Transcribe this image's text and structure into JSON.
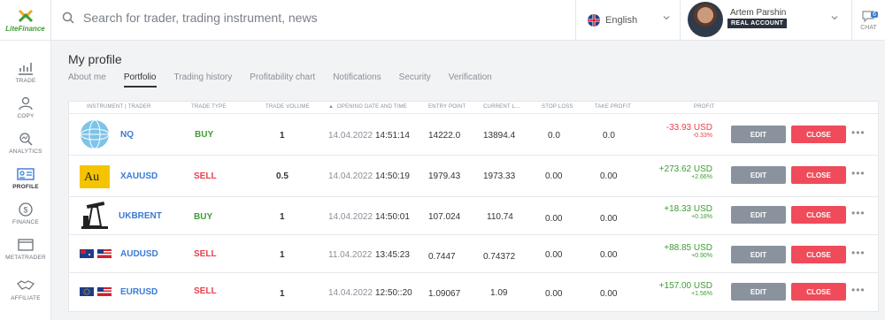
{
  "header": {
    "logo_text": "LiteFinance",
    "search_placeholder": "Search for trader, trading instrument, news",
    "language": "English",
    "user_name": "Artem Parshin",
    "account_type": "REAL ACCOUNT",
    "chat_label": "CHAT",
    "chat_count": "6"
  },
  "sidebar": {
    "items": [
      {
        "label": "TRADE",
        "icon": "chart-icon"
      },
      {
        "label": "COPY",
        "icon": "person-icon"
      },
      {
        "label": "ANALYTICS",
        "icon": "analytics-icon"
      },
      {
        "label": "PROFILE",
        "icon": "profile-card-icon",
        "active": true
      },
      {
        "label": "FINANCE",
        "icon": "dollar-icon"
      },
      {
        "label": "METATRADER",
        "icon": "window-icon"
      },
      {
        "label": "AFFILIATE",
        "icon": "handshake-icon"
      }
    ]
  },
  "page": {
    "title": "My profile",
    "tabs": [
      "About me",
      "Portfolio",
      "Trading history",
      "Profitability chart",
      "Notifications",
      "Security",
      "Verification"
    ],
    "active_tab": "Portfolio"
  },
  "table": {
    "headers": {
      "instrument": "INSTRUMENT | TRADER",
      "trade_type": "TRADE TYPE",
      "trade_volume": "TRADE VOLUME",
      "opening": "OPENING DATE AND TIME",
      "entry": "ENTRY POINT",
      "current": "CURRENT L...",
      "stop_loss": "STOP LOSS",
      "take_profit": "TAKE PROFIT",
      "profit": "PROFIT"
    },
    "sort_indicator": "▲",
    "edit_label": "EDIT",
    "close_label": "CLOSE",
    "more_label": "•••",
    "rows": [
      {
        "symbol": "NQ",
        "icon": "nasdaq-globe-icon",
        "type": "BUY",
        "volume": "1",
        "date": "14.04.2022",
        "time": "14:51:14",
        "entry": "14222.0",
        "current": "13894.4",
        "sl": "0.0",
        "tp": "0.0",
        "profit": "-33.93 USD",
        "pct": "-0.33%",
        "sign": "neg"
      },
      {
        "symbol": "XAUUSD",
        "icon": "gold-au-icon",
        "type": "SELL",
        "volume": "0.5",
        "date": "14.04.2022",
        "time": "14:50:19",
        "entry": "1979.43",
        "current": "1973.33",
        "sl": "0.00",
        "tp": "0.00",
        "profit": "+273.62 USD",
        "pct": "+2.66%",
        "sign": "pos"
      },
      {
        "symbol": "UKBRENT",
        "icon": "oil-pump-icon",
        "type": "BUY",
        "volume": "1",
        "date": "14.04.2022",
        "time": "14:50:01",
        "entry": "107.024",
        "current": "110.74",
        "sl": "0.00",
        "tp": "0.00",
        "profit": "+18.33 USD",
        "pct": "+0.18%",
        "sign": "pos"
      },
      {
        "symbol": "AUDUSD",
        "icon": "au-us-flags-icon",
        "type": "SELL",
        "volume": "1",
        "date": "11.04.2022",
        "time": "13:45:23",
        "entry": "0.7447",
        "current": "0.74372",
        "sl": "0.00",
        "tp": "0.00",
        "profit": "+88.85 USD",
        "pct": "+0.90%",
        "sign": "pos"
      },
      {
        "symbol": "EURUSD",
        "icon": "eu-us-flags-icon",
        "type": "SELL",
        "volume": "1",
        "date": "14.04.2022",
        "time": "12:50::20",
        "entry": "1.09067",
        "current": "1.09",
        "sl": "0.00",
        "tp": "0.00",
        "profit": "+157.00 USD",
        "pct": "+1.56%",
        "sign": "pos"
      }
    ]
  },
  "colors": {
    "buy": "#3f9c35",
    "sell": "#e8414d",
    "link": "#3a7bd5",
    "edit_button": "#8a929e",
    "close_button": "#f04b5a"
  }
}
